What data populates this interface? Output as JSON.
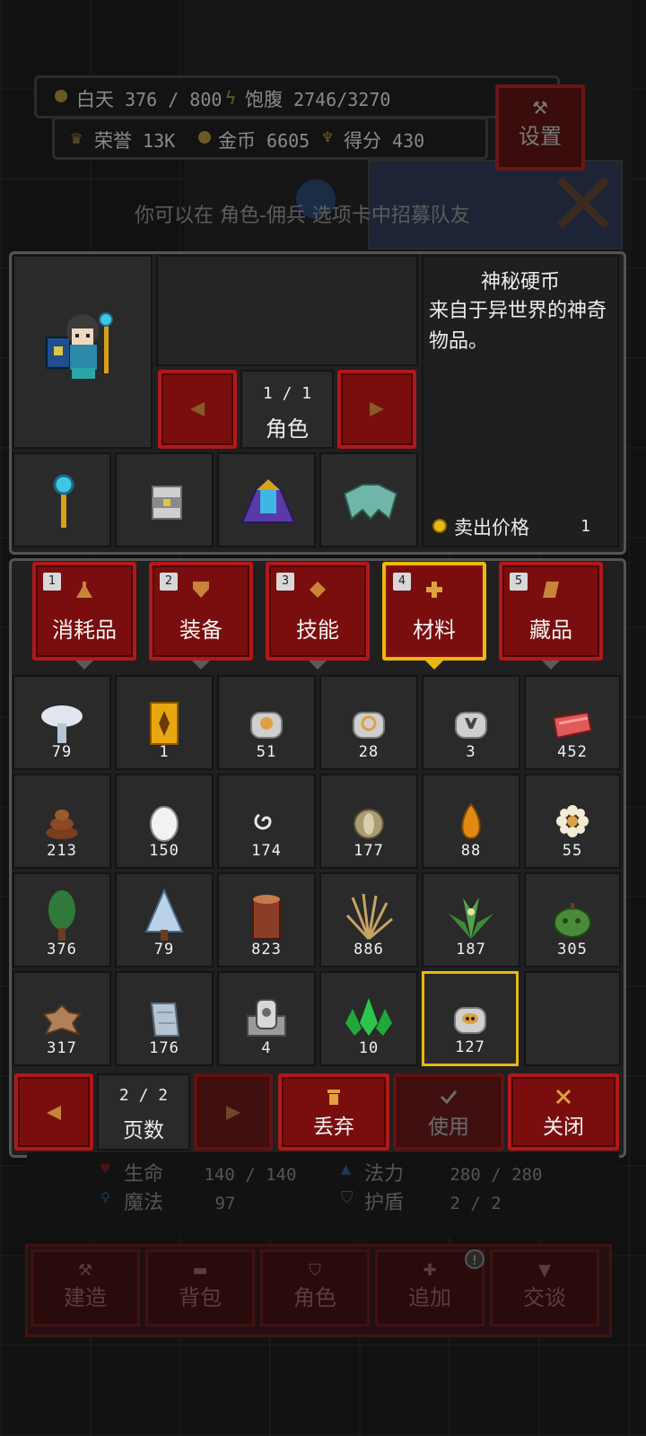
{
  "hud": {
    "day_label": "白天",
    "day_value": "376 / 800",
    "food_label": "饱腹",
    "food_value": "2746/3270",
    "honor_label": "荣誉",
    "honor_value": "13K",
    "gold_label": "金币",
    "gold_value": "6605",
    "score_label": "得分",
    "score_value": "430",
    "settings_label": "设置",
    "hint": "你可以在 角色-佣兵 选项卡中招募队友"
  },
  "character": {
    "page": "1 / 1",
    "label": "角色"
  },
  "item_info": {
    "name": "神秘硬币",
    "description": "来自于异世界的神奇物品。",
    "sell_label": "卖出价格",
    "sell_value": "1"
  },
  "tabs": [
    {
      "num": "1",
      "label": "消耗品",
      "icon": "potion-icon"
    },
    {
      "num": "2",
      "label": "装备",
      "icon": "shield-icon"
    },
    {
      "num": "3",
      "label": "技能",
      "icon": "diamond-icon"
    },
    {
      "num": "4",
      "label": "材料",
      "icon": "cross-icon",
      "selected": true
    },
    {
      "num": "5",
      "label": "藏品",
      "icon": "scroll-icon"
    }
  ],
  "inventory": [
    {
      "icon": "mushroom-icon",
      "count": "79"
    },
    {
      "icon": "golden-card-icon",
      "count": "1"
    },
    {
      "icon": "skull-coin-icon",
      "count": "51"
    },
    {
      "icon": "swirl-coin-icon",
      "count": "28"
    },
    {
      "icon": "horn-coin-icon",
      "count": "3"
    },
    {
      "icon": "meat-icon",
      "count": "452"
    },
    {
      "icon": "dung-icon",
      "count": "213"
    },
    {
      "icon": "egg-icon",
      "count": "150"
    },
    {
      "icon": "spiral-icon",
      "count": "174"
    },
    {
      "icon": "seed-icon",
      "count": "177"
    },
    {
      "icon": "amber-drop-icon",
      "count": "88"
    },
    {
      "icon": "flower-icon",
      "count": "55"
    },
    {
      "icon": "pine-tree-icon",
      "count": "376"
    },
    {
      "icon": "snow-tree-icon",
      "count": "79"
    },
    {
      "icon": "log-icon",
      "count": "823"
    },
    {
      "icon": "grass-icon",
      "count": "886"
    },
    {
      "icon": "herb-icon",
      "count": "187"
    },
    {
      "icon": "green-fruit-icon",
      "count": "305"
    },
    {
      "icon": "leather-icon",
      "count": "317"
    },
    {
      "icon": "cloth-icon",
      "count": "176"
    },
    {
      "icon": "stone-idol-icon",
      "count": "4"
    },
    {
      "icon": "emerald-icon",
      "count": "10"
    },
    {
      "icon": "mystery-coin-icon",
      "count": "127",
      "selected": true
    },
    {
      "icon": "empty",
      "count": ""
    }
  ],
  "pager": {
    "page": "2 / 2",
    "label": "页数",
    "discard_label": "丢弃",
    "use_label": "使用",
    "close_label": "关闭"
  },
  "stats": {
    "hp_label": "生命",
    "hp_value": "140 / 140",
    "mana_label": "法力",
    "mana_value": "280 / 280",
    "magic_label": "魔法",
    "magic_value": "97",
    "shield_label": "护盾",
    "shield_value": "2 / 2"
  },
  "bottom_nav": [
    "建造",
    "背包",
    "角色",
    "追加",
    "交谈"
  ],
  "colors": {
    "red_button": "#7a0e0e",
    "red_border": "#b21818",
    "selected_gold": "#e8b90e",
    "panel_border": "#545454"
  }
}
